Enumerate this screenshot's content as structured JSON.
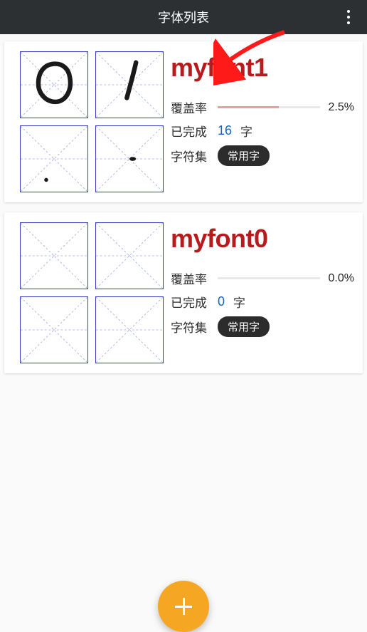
{
  "appbar": {
    "title": "字体列表"
  },
  "labels": {
    "coverage": "覆盖率",
    "completed": "已完成",
    "charset": "字符集",
    "unit": "字"
  },
  "fonts": [
    {
      "name": "myfont1",
      "coverage_pct_text": "2.5%",
      "coverage_bar_width_pct": 60,
      "completed_count": "16",
      "charset_label": "常用字",
      "glyphs": [
        "circle",
        "slash",
        "dot-low",
        "dot-mid"
      ]
    },
    {
      "name": "myfont0",
      "coverage_pct_text": "0.0%",
      "coverage_bar_width_pct": 0,
      "completed_count": "0",
      "charset_label": "常用字",
      "glyphs": [
        "empty",
        "empty",
        "empty",
        "empty"
      ]
    }
  ],
  "fab": {
    "aria": "add-font"
  },
  "annotation": {
    "visible": true
  }
}
